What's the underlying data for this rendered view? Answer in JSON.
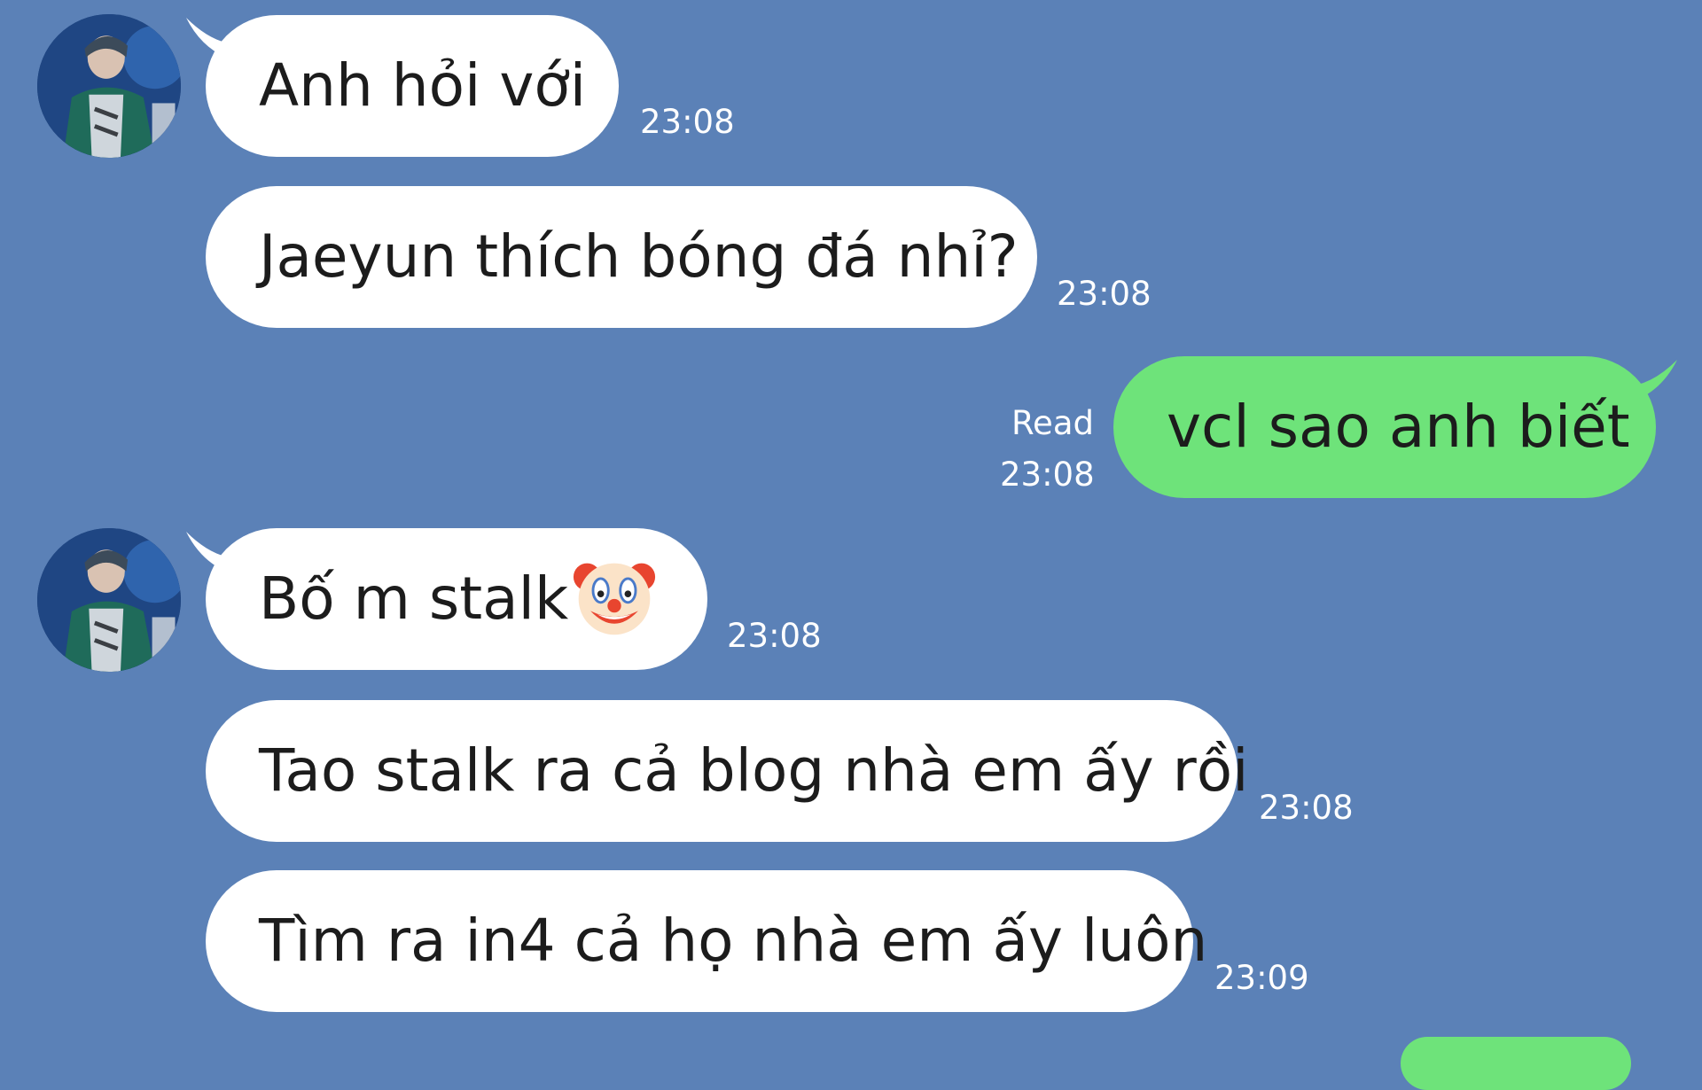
{
  "messages": [
    {
      "id": "m1",
      "direction": "received",
      "text": "Anh hỏi với",
      "time": "23:08"
    },
    {
      "id": "m2",
      "direction": "received",
      "text": "Jaeyun thích bóng đá nhỉ?",
      "time": "23:08"
    },
    {
      "id": "m3",
      "direction": "sent",
      "text": "vcl sao anh biết",
      "status": "Read",
      "time": "23:08"
    },
    {
      "id": "m4",
      "direction": "received",
      "text": "Bố m stalk",
      "emoji": "clown-face",
      "time": "23:08"
    },
    {
      "id": "m5",
      "direction": "received",
      "text": "Tao stalk ra cả blog nhà em ấy rồi",
      "time": "23:08"
    },
    {
      "id": "m6",
      "direction": "received",
      "text": "Tìm ra in4 cả họ nhà em ấy luôn",
      "time": "23:09"
    }
  ],
  "colors": {
    "background": "#5b81b7",
    "received_bubble": "#ffffff",
    "sent_bubble": "#6ee37a",
    "text": "#1c1c1c",
    "timestamp": "#ffffff"
  }
}
